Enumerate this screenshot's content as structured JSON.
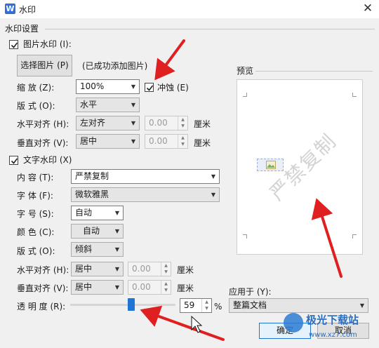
{
  "window": {
    "app_icon": "W",
    "title": "水印",
    "close_glyph": "✕"
  },
  "section_title": "水印设置",
  "image_wm": {
    "checkbox_label": "图片水印 (I):",
    "checked": true,
    "choose_button": "选择图片 (P)",
    "status": "(已成功添加图片)",
    "scale_label": "缩    放 (Z):",
    "scale_value": "100%",
    "washout_label": "冲蚀 (E)",
    "washout_checked": true,
    "layout_label": "版    式 (O):",
    "layout_value": "水平",
    "halign_label": "水平对齐 (H):",
    "halign_value": "左对齐",
    "halign_offset": "0.00",
    "valign_label": "垂直对齐 (V):",
    "valign_value": "居中",
    "valign_offset": "0.00",
    "unit": "厘米"
  },
  "text_wm": {
    "checkbox_label": "文字水印 (X)",
    "checked": true,
    "content_label": "内    容 (T):",
    "content_value": "严禁复制",
    "font_label": "字    体 (F):",
    "font_value": "微软雅黑",
    "size_label": "字    号 (S):",
    "size_value": "自动",
    "color_label": "颜    色 (C):",
    "color_value": "自动",
    "layout_label": "版    式 (O):",
    "layout_value": "倾斜",
    "halign_label": "水平对齐 (H):",
    "halign_value": "居中",
    "halign_offset": "0.00",
    "valign_label": "垂直对齐 (V):",
    "valign_value": "居中",
    "valign_offset": "0.00",
    "unit": "厘米",
    "transparency_label": "透 明 度 (R):",
    "transparency_value": "59",
    "transparency_unit": "%"
  },
  "preview": {
    "label": "预览",
    "watermark_text": "严禁复制"
  },
  "apply": {
    "label": "应用于 (Y):",
    "value": "整篇文档"
  },
  "footer": {
    "ok": "确定",
    "cancel": "取消"
  },
  "site_watermark": {
    "name": "极光下载站",
    "url": "www.xz7.com"
  },
  "colors": {
    "accent": "#1f75d6",
    "annotation_arrow": "#e02020",
    "icon": "#2f6fd6"
  }
}
